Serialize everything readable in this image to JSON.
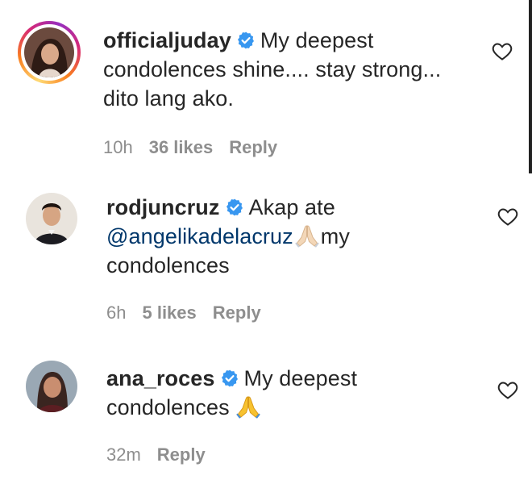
{
  "comments": [
    {
      "username": "officialjuday",
      "text": "My deepest condolences shine.... stay strong... dito lang ako.",
      "line1": "My deepest",
      "line2": "condolences shine.... stay strong...",
      "line3": "dito lang ako.",
      "time": "10h",
      "likes": "36 likes",
      "reply": "Reply",
      "avatar_icon": "profile-photo",
      "has_story_ring": true
    },
    {
      "username": "rodjuncruz",
      "line1": "Akap ate",
      "mention": "@angelikadelacruz",
      "line2_tail": "my",
      "line3": "condolences",
      "emoji_icon": "folded-hands-light",
      "time": "6h",
      "likes": "5 likes",
      "reply": "Reply",
      "avatar_icon": "profile-photo"
    },
    {
      "username": "ana_roces",
      "line1": "My deepest",
      "line2": "condolences",
      "emoji_icon": "folded-hands-yellow",
      "time": "32m",
      "reply": "Reply",
      "avatar_icon": "profile-photo"
    }
  ],
  "icons": {
    "verified": "verified-badge-icon",
    "like": "heart-outline-icon"
  },
  "colors": {
    "verified_blue": "#3897f0",
    "mention": "#00376b",
    "meta_gray": "#8e8e8e",
    "text": "#262626"
  }
}
